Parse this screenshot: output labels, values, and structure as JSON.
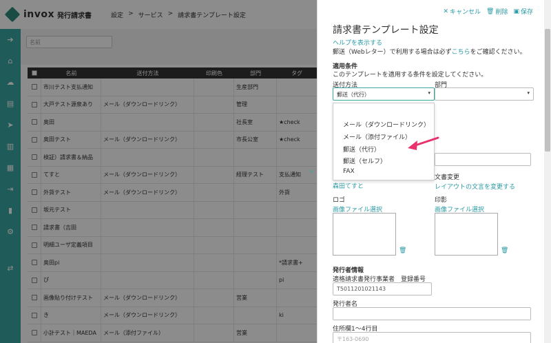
{
  "app": {
    "logo_text": "invox",
    "logo_sub": "発行請求書",
    "breadcrumb": [
      "設定",
      ">",
      "サービス",
      ">",
      "請求書テンプレート設定"
    ]
  },
  "sidebar": {
    "icons": [
      "arrow-right-circle-icon",
      "home-icon",
      "cloud-upload-icon",
      "document-icon",
      "send-icon",
      "bank-icon",
      "building-icon",
      "file-export-icon",
      "chart-icon",
      "gear-icon",
      "transfer-icon"
    ]
  },
  "filter": {
    "placeholder": "名前"
  },
  "table": {
    "headers": [
      "名前",
      "送付方法",
      "印刷色",
      "部門",
      "タグ"
    ],
    "rows": [
      [
        "市川テスト支払通知",
        "",
        "",
        "生産部門",
        ""
      ],
      [
        "大戸テスト源泉あり",
        "メール（ダウンロードリンク）",
        "",
        "管理",
        ""
      ],
      [
        "奥田",
        "",
        "",
        "社長室",
        "★check"
      ],
      [
        "奥田テスト",
        "メール（ダウンロードリンク）",
        "",
        "市長公室",
        "★check"
      ],
      [
        "検証）請求書＆納品",
        "",
        "",
        "",
        ""
      ],
      [
        "てすと",
        "メール（ダウンロードリンク）",
        "",
        "経理テスト",
        "支払通知"
      ],
      [
        "外貨テスト",
        "メール（ダウンロードリンク）",
        "",
        "",
        "外貨"
      ],
      [
        "坂元テスト",
        "",
        "",
        "",
        ""
      ],
      [
        "請求書（吉田",
        "",
        "",
        "",
        ""
      ],
      [
        "明細ユーザ定義項目",
        "",
        "",
        "",
        ""
      ],
      [
        "奥田pi",
        "",
        "",
        "",
        "*請求書+"
      ],
      [
        "ぴ",
        "",
        "",
        "",
        "pi"
      ],
      [
        "画像貼り付けテスト",
        "メール（ダウンロードリンク）",
        "",
        "営業",
        ""
      ],
      [
        "き",
        "メール（ダウンロードリンク）",
        "",
        "",
        "ki"
      ],
      [
        "小計テスト｜MAEDA",
        "メール（添付ファイル）",
        "",
        "営業",
        ""
      ]
    ]
  },
  "panel": {
    "actions": {
      "cancel": "キャンセル",
      "delete": "削除",
      "save": "保存"
    },
    "title": "請求書テンプレート設定",
    "help_link": "ヘルプを表示する",
    "note_prefix": "郵送（Webレター）で利用する場合は必ず",
    "note_link": "こちら",
    "note_suffix": "をご確認ください。",
    "conditions_heading": "適用条件",
    "conditions_desc": "このテンプレートを適用する条件を設定してください。",
    "send_method_label": "送付方法",
    "send_method_value": "郵送（代行）",
    "department_label": "部門",
    "department_value": "",
    "send_options": [
      "メール（ダウンロードリンク）",
      "メール（添付ファイル）",
      "郵送（代行）",
      "郵送（セルフ）",
      "FAX"
    ],
    "doc_change_label": "文書変更",
    "template_link": "森田てすと",
    "layout_link": "レイアウトの文言を変更する",
    "logo_label": "ロゴ",
    "logo_select": "画像ファイル選択",
    "seal_label": "印影",
    "seal_select": "画像ファイル選択",
    "issuer_heading": "発行者情報",
    "reg_label": "適格請求書発行事業者　登録番号",
    "reg_value": "T5011201021143",
    "issuer_name_label": "発行者名",
    "address_label": "住所欄1〜4行目",
    "address_placeholder": "〒163-0690"
  },
  "colors": {
    "accent": "#3aa7a0",
    "link": "#2a9aa5",
    "arrow": "#e8336d"
  }
}
